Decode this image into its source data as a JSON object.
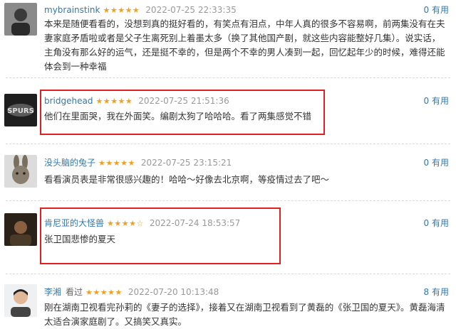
{
  "reviews": [
    {
      "user": "mybrainstink",
      "tag": "",
      "stars": "★★★★★",
      "time": "2022-07-25 22:33:35",
      "useful": "0 有用",
      "content": "本来是随便看看的，没想到真的挺好看的，有笑点有泪点，中年人真的很多不容易啊，前两集没有在夫妻家庭矛盾啦或者是父子生离死别上着墨太多（换了其他国产剧，就这些内容能整好几集）。说实话，主角没有那么好的运气，还是挺不幸的，但是两个不幸的男人凑到一起，回忆起年少的时候，难得还能体会到一种幸福"
    },
    {
      "user": "bridgehead",
      "tag": "",
      "stars": "★★★★★",
      "time": "2022-07-25 21:51:36",
      "useful": "0 有用",
      "content": "他们在里面哭，我在外面笑。编剧太狗了哈哈哈。看了两集感觉不错"
    },
    {
      "user": "没头脑的兔子",
      "tag": "",
      "stars": "★★★★★",
      "time": "2022-07-25 23:15:21",
      "useful": "0 有用",
      "content": "看看演员表是非常很感兴趣的！哈哈～好像去北京啊，等疫情过去了吧～"
    },
    {
      "user": "肯尼亚的大怪兽",
      "tag": "",
      "stars": "★★★★☆",
      "time": "2022-07-24 18:53:57",
      "useful": "0 有用",
      "content": "张卫国悲惨的夏天"
    },
    {
      "user": "李湘",
      "tag": "看过",
      "stars": "★★★★★",
      "time": "2022-07-20 10:13:48",
      "useful": "8 有用",
      "content": "刚在湖南卫视看完孙莉的《妻子的选择》，接着又在湖南卫视看到了黄磊的《张卫国的夏天》。黄磊海清太适合演家庭剧了。又搞笑又真实。"
    }
  ],
  "colors": {
    "username": "#3377aa",
    "stars": "#f0a020",
    "highlight_box": "#e02020"
  }
}
